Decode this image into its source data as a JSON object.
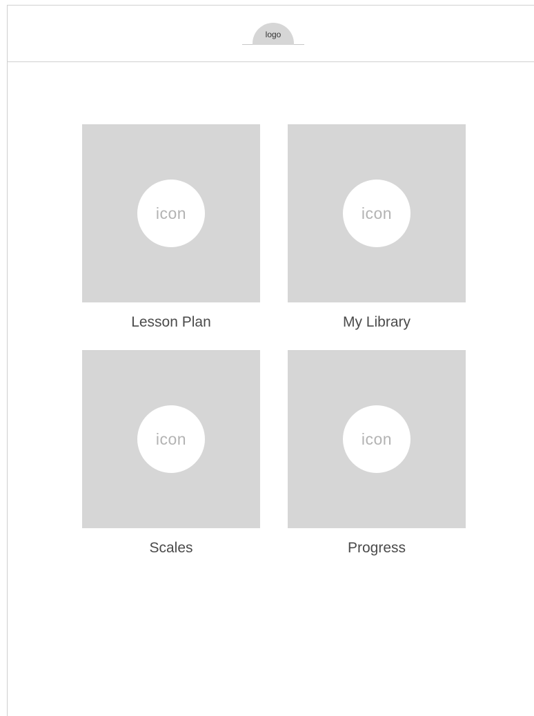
{
  "header": {
    "logo_text": "logo"
  },
  "tiles": [
    {
      "icon_text": "icon",
      "label": "Lesson Plan"
    },
    {
      "icon_text": "icon",
      "label": "My Library"
    },
    {
      "icon_text": "icon",
      "label": "Scales"
    },
    {
      "icon_text": "icon",
      "label": "Progress"
    }
  ],
  "colors": {
    "tile_background": "#d6d6d6",
    "icon_background": "#ffffff",
    "divider": "#cfcfcf"
  }
}
